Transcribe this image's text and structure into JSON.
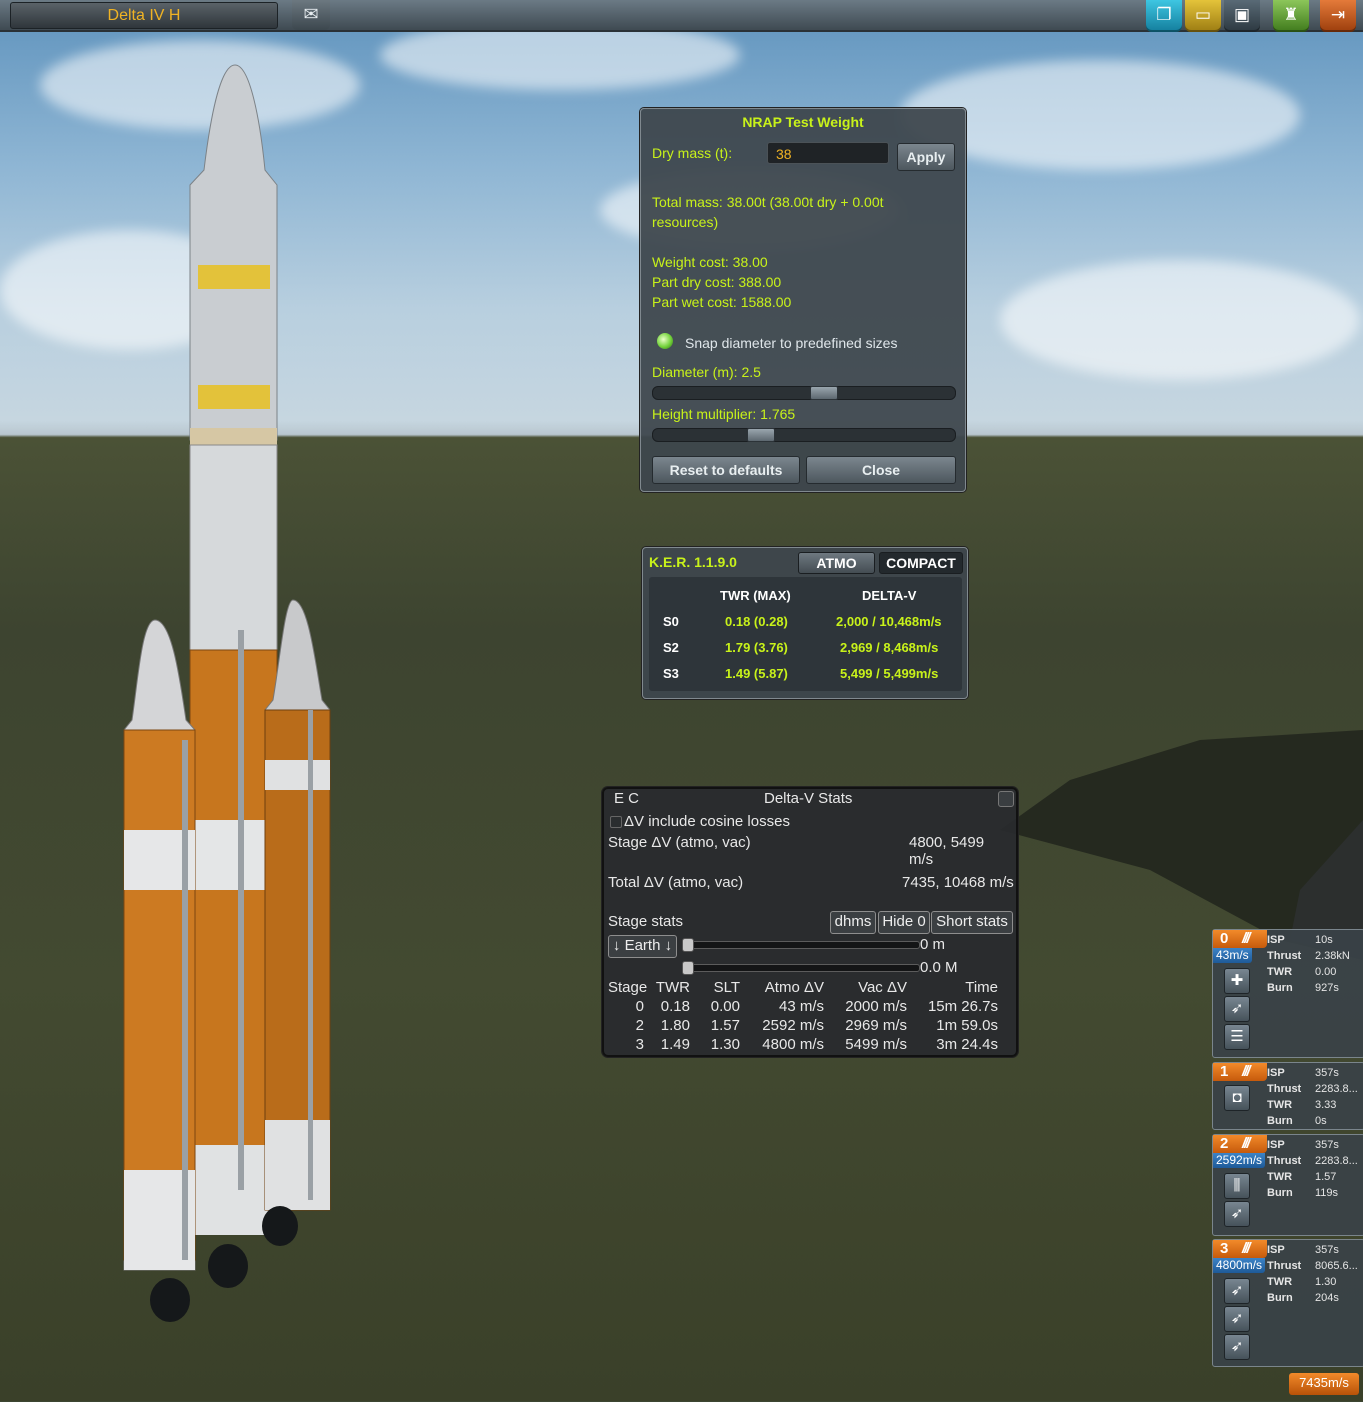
{
  "topbar": {
    "vessel_name": "Delta IV H",
    "mail_icon": "envelope-icon",
    "right_buttons": [
      {
        "name": "new-craft",
        "icon": "new-file-icon",
        "color": "#1ea8c8"
      },
      {
        "name": "load-craft",
        "icon": "folder-icon",
        "color": "#c8a21e"
      },
      {
        "name": "save-craft",
        "icon": "floppy-icon",
        "color": "#3a4a56"
      },
      {
        "name": "launch",
        "icon": "launch-pad-icon",
        "color": "#6aa83a"
      },
      {
        "name": "exit",
        "icon": "exit-icon",
        "color": "#c8561e"
      }
    ]
  },
  "nrap": {
    "title": "NRAP Test Weight",
    "dry_mass_label": "Dry mass (t):",
    "dry_mass_value": "38",
    "apply_label": "Apply",
    "total_mass_line1": "Total mass: 38.00t (38.00t dry + 0.00t",
    "total_mass_line2": "resources)",
    "weight_cost": "Weight cost: 38.00",
    "part_dry_cost": "Part dry cost: 388.00",
    "part_wet_cost": "Part wet cost: 1588.00",
    "snap_label": "Snap diameter to predefined sizes",
    "diameter_label": "Diameter (m):  2.5",
    "diameter_fraction": 0.57,
    "height_label": "Height multiplier: 1.765",
    "height_fraction": 0.34,
    "reset_label": "Reset to defaults",
    "close_label": "Close"
  },
  "ker": {
    "title": "K.E.R. 1.1.9.0",
    "atmo_label": "ATMO",
    "compact_label": "COMPACT",
    "col_twr": "TWR (MAX)",
    "col_dv": "DELTA-V",
    "rows": [
      {
        "stage": "S0",
        "twr": "0.18 (0.28)",
        "dv": "2,000 / 10,468m/s"
      },
      {
        "stage": "S2",
        "twr": "1.79 (3.76)",
        "dv": "2,969 / 8,468m/s"
      },
      {
        "stage": "S3",
        "twr": "1.49 (5.87)",
        "dv": "5,499 / 5,499m/s"
      }
    ]
  },
  "dvstats": {
    "ec": "E  C",
    "title": "Delta-V Stats",
    "cosine_label": "ΔV include cosine losses",
    "stage_dv_label": "Stage ΔV (atmo, vac)",
    "stage_dv_value_1": "4800, 5499",
    "stage_dv_value_2": "m/s",
    "total_dv_label": "Total ΔV (atmo, vac)",
    "total_dv_value": "7435, 10468 m/s",
    "stage_stats_label": "Stage stats",
    "dhms_label": "dhms",
    "hide0_label": "Hide 0",
    "short_stats_label": "Short stats",
    "body_label": "↓ Earth ↓",
    "slider1_value": "0 m",
    "slider2_value": "0.0 M",
    "headers": [
      "Stage",
      "TWR",
      "SLT",
      "Atmo ΔV",
      "Vac ΔV",
      "Time"
    ],
    "rows": [
      [
        "0",
        "0.18",
        "0.00",
        "43 m/s",
        "2000 m/s",
        "15m 26.7s"
      ],
      [
        "2",
        "1.80",
        "1.57",
        "2592 m/s",
        "2969 m/s",
        "1m 59.0s"
      ],
      [
        "3",
        "1.49",
        "1.30",
        "4800 m/s",
        "5499 m/s",
        "3m 24.4s"
      ]
    ]
  },
  "staging": [
    {
      "num": "0",
      "dv": "43m/s",
      "isp": "10s",
      "thrust": "2.38kN",
      "twr": "0.00",
      "burn": "927s",
      "icons": [
        "decoupler-icon",
        "engine-icon",
        "fairing-icon"
      ]
    },
    {
      "num": "1",
      "dv": "",
      "isp": "357s",
      "thrust": "2283.8...",
      "twr": "3.33",
      "burn": "0s",
      "icons": [
        "clamp-icon"
      ]
    },
    {
      "num": "2",
      "dv": "2592m/s",
      "isp": "357s",
      "thrust": "2283.8...",
      "twr": "1.57",
      "burn": "119s",
      "icons": [
        "separator-icon",
        "engine-icon"
      ]
    },
    {
      "num": "3",
      "dv": "4800m/s",
      "isp": "357s",
      "thrust": "8065.6...",
      "twr": "1.30",
      "burn": "204s",
      "icons": [
        "engine-icon",
        "engine-icon",
        "engine-icon"
      ]
    }
  ],
  "labels": {
    "isp": "ISP",
    "thrust": "Thrust",
    "twr": "TWR",
    "burn": "Burn"
  },
  "total_dv": "7435m/s",
  "colors": {
    "accent_green": "#c8f21a",
    "orange": "#f28a2a",
    "blue": "#2e72b8"
  }
}
